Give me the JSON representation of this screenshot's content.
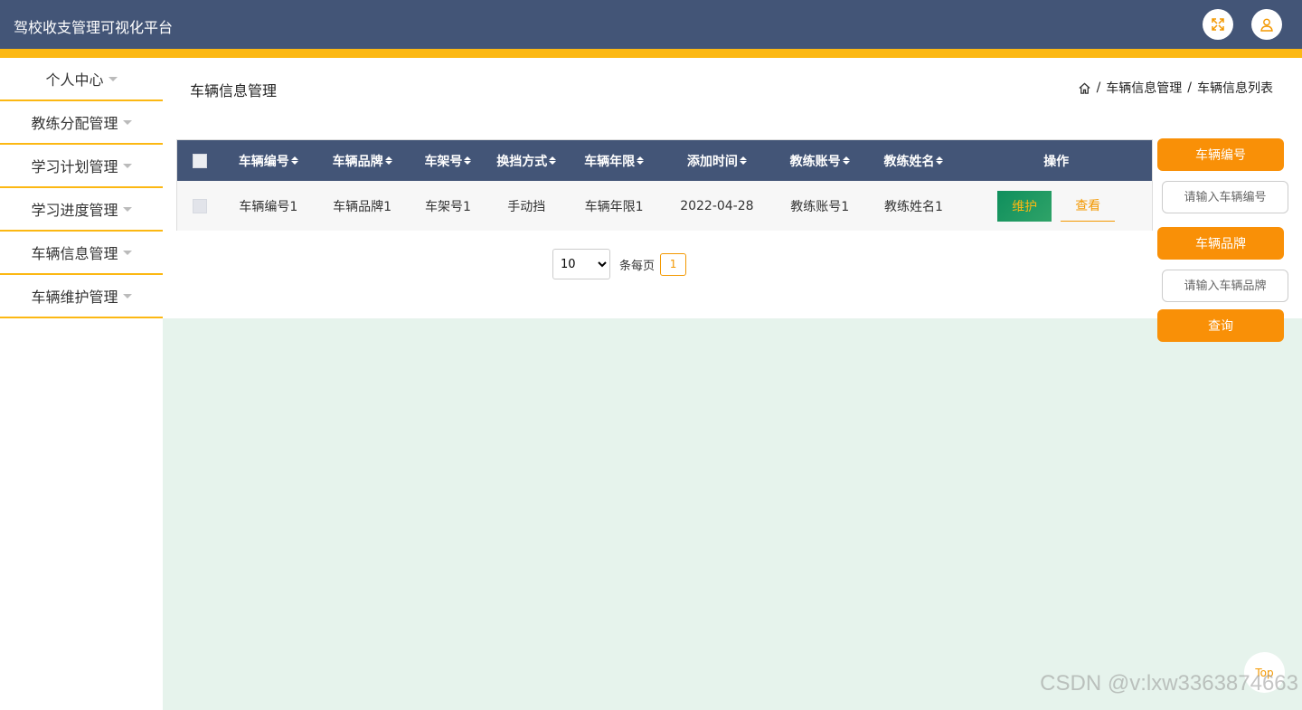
{
  "header": {
    "title": "驾校收支管理可视化平台",
    "fullscreen_icon": "expand-icon",
    "user_icon": "user-icon"
  },
  "sidebar": {
    "items": [
      {
        "label": "个人中心"
      },
      {
        "label": "教练分配管理"
      },
      {
        "label": "学习计划管理"
      },
      {
        "label": "学习进度管理"
      },
      {
        "label": "车辆信息管理"
      },
      {
        "label": "车辆维护管理"
      }
    ]
  },
  "page": {
    "title": "车辆信息管理"
  },
  "breadcrumb": {
    "home_icon": "home-icon",
    "level1": "车辆信息管理",
    "level2": "车辆信息列表",
    "separator": "/"
  },
  "table": {
    "headers": [
      "车辆编号",
      "车辆品牌",
      "车架号",
      "换挡方式",
      "车辆年限",
      "添加时间",
      "教练账号",
      "教练姓名",
      "操作"
    ],
    "rows": [
      {
        "cells": [
          "车辆编号1",
          "车辆品牌1",
          "车架号1",
          "手动挡",
          "车辆年限1",
          "2022-04-28",
          "教练账号1",
          "教练姓名1"
        ],
        "actions": {
          "maintain": "维护",
          "view": "查看"
        }
      }
    ]
  },
  "pager": {
    "page_size": "10",
    "per_page_label": "条每页",
    "current_page": "1"
  },
  "search": {
    "field1_label": "车辆编号",
    "field1_placeholder": "请输入车辆编号",
    "field2_label": "车辆品牌",
    "field2_placeholder": "请输入车辆品牌",
    "query_label": "查询"
  },
  "back_to_top": "Top",
  "watermark": "CSDN @v:lxw3363874663",
  "colors": {
    "header": "#435577",
    "accent_gold": "#fcb813",
    "orange": "#f99007",
    "content_bg": "#e6f3ec"
  }
}
